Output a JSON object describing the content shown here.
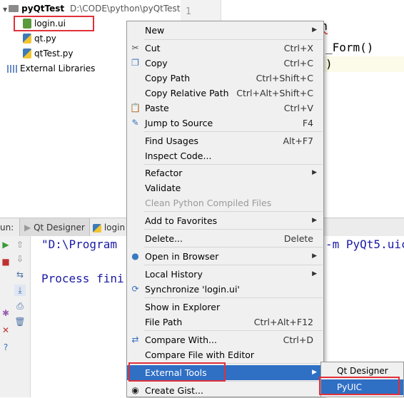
{
  "project_tree": {
    "root_name": "pyQtTest",
    "root_path": "D:\\CODE\\python\\pyQtTest",
    "files": [
      "login.ui",
      "qt.py",
      "qtTest.py"
    ],
    "external": "External Libraries"
  },
  "editor": {
    "line_number": "1",
    "line1": "import login",
    "line2": "_Form()",
    "line3": ")"
  },
  "bottom_tabs": {
    "run_prefix": "un:",
    "qt_designer": "Qt Designer",
    "login": "login"
  },
  "console": {
    "line1": "\"D:\\Program",
    "line1_tail": "-m PyQt5.uic",
    "line2": "Process fini"
  },
  "context_menu": {
    "items": [
      {
        "label": "New",
        "shortcut": "",
        "submenu": true
      },
      {
        "label": "Cut",
        "shortcut": "Ctrl+X"
      },
      {
        "label": "Copy",
        "shortcut": "Ctrl+C"
      },
      {
        "label": "Copy Path",
        "shortcut": "Ctrl+Shift+C"
      },
      {
        "label": "Copy Relative Path",
        "shortcut": "Ctrl+Alt+Shift+C"
      },
      {
        "label": "Paste",
        "shortcut": "Ctrl+V"
      },
      {
        "label": "Jump to Source",
        "shortcut": "F4"
      },
      {
        "label": "Find Usages",
        "shortcut": "Alt+F7"
      },
      {
        "label": "Inspect Code...",
        "shortcut": ""
      },
      {
        "label": "Refactor",
        "shortcut": "",
        "submenu": true
      },
      {
        "label": "Validate",
        "shortcut": ""
      },
      {
        "label": "Clean Python Compiled Files",
        "shortcut": "",
        "disabled": true
      },
      {
        "label": "Add to Favorites",
        "shortcut": "",
        "submenu": true
      },
      {
        "label": "Delete...",
        "shortcut": "Delete"
      },
      {
        "label": "Open in Browser",
        "shortcut": "",
        "submenu": true
      },
      {
        "label": "Local History",
        "shortcut": "",
        "submenu": true
      },
      {
        "label": "Synchronize 'login.ui'",
        "shortcut": ""
      },
      {
        "label": "Show in Explorer",
        "shortcut": ""
      },
      {
        "label": "File Path",
        "shortcut": "Ctrl+Alt+F12"
      },
      {
        "label": "Compare With...",
        "shortcut": "Ctrl+D"
      },
      {
        "label": "Compare File with Editor",
        "shortcut": ""
      },
      {
        "label": "External Tools",
        "shortcut": "",
        "submenu": true,
        "highlighted": true
      },
      {
        "label": "Create Gist...",
        "shortcut": ""
      }
    ]
  },
  "external_tools_submenu": {
    "items": [
      "Qt Designer",
      "PyUIC"
    ]
  },
  "colors": {
    "highlight": "#2f6fc4",
    "annotation_red": "#e0303a",
    "keyword_blue": "#000080"
  }
}
